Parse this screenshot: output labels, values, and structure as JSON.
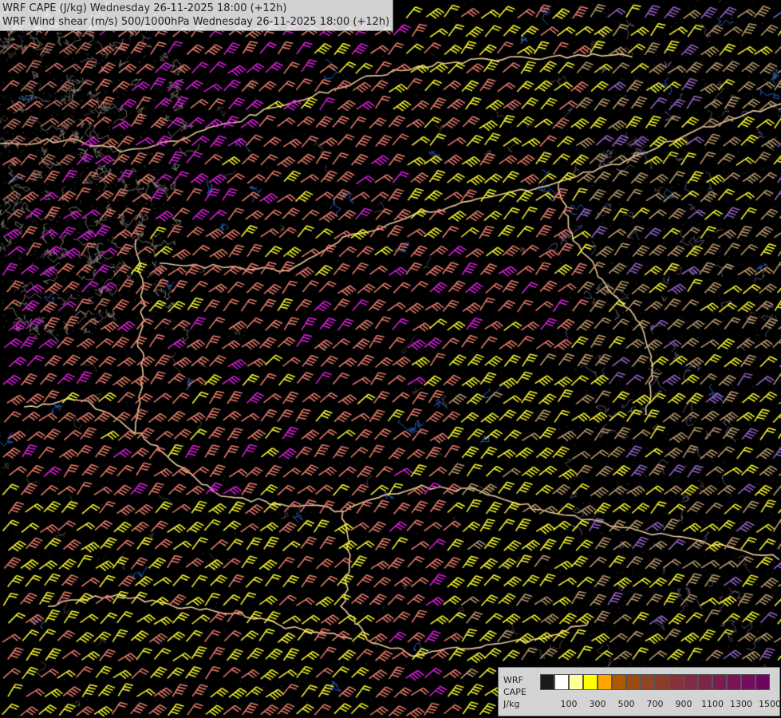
{
  "titles": {
    "line1": "WRF CAPE (J/kg) Wednesday 26-11-2025 18:00 (+12h)",
    "line2": "WRF Wind shear (m/s) 500/1000hPa Wednesday 26-11-2025 18:00 (+12h)"
  },
  "legend": {
    "line1": "WRF",
    "line2": "CAPE",
    "line3": "J/kg",
    "colors": [
      "#1a1a1a",
      "#ffffff",
      "#ffff99",
      "#ffff00",
      "#ffa500",
      "#b05a00",
      "#9a4b10",
      "#924520",
      "#8c3c28",
      "#87313a",
      "#822b44",
      "#7d2447",
      "#7c1c4f",
      "#7a1457",
      "#750c5e",
      "#6e0660"
    ],
    "ticks": [
      "100",
      "300",
      "500",
      "700",
      "900",
      "1100",
      "1300",
      "1500"
    ]
  },
  "palette": {
    "background": "#000000",
    "barb_yellow": "#ffff33",
    "barb_salmon": "#f08070",
    "barb_magenta": "#e020e0",
    "barb_rose": "#c87a6a",
    "barb_purple": "#9a66cc",
    "barb_tan": "#c0a070",
    "border": "#e8c89a",
    "river": "#2a5cb8",
    "terrain_contour": "#a09080"
  }
}
